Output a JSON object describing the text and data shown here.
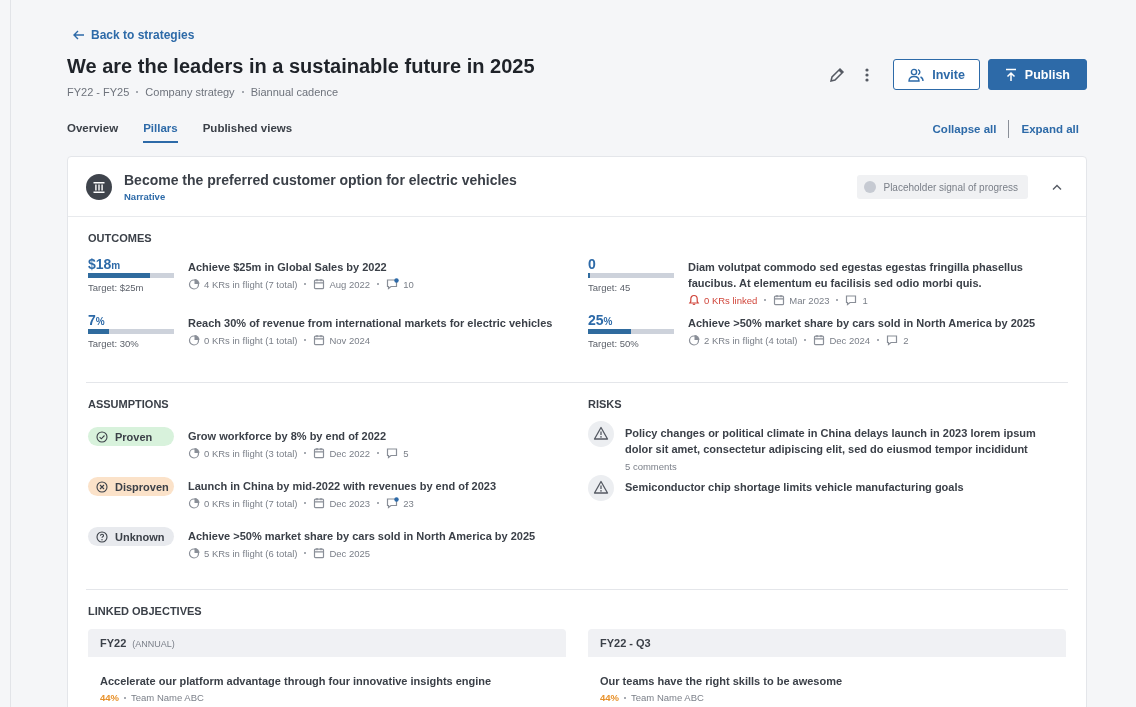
{
  "back_link": "Back to strategies",
  "title": "We are the leaders in a sustainable future in 2025",
  "subtitle": [
    "FY22 - FY25",
    "Company strategy",
    "Biannual cadence"
  ],
  "actions": {
    "invite": "Invite",
    "publish": "Publish"
  },
  "tabs": [
    {
      "label": "Overview",
      "selected": false
    },
    {
      "label": "Pillars",
      "selected": true
    },
    {
      "label": "Published views",
      "selected": false
    }
  ],
  "view_controls": [
    "Collapse all",
    "Expand all"
  ],
  "pillar": {
    "title": "Become the preferred customer option for electric vehicles",
    "link": "Narrative",
    "progress_signal": "Placeholder signal of progress",
    "expanded": true,
    "outcomes_heading": "OUTCOMES",
    "outcomes": [
      {
        "value": "$18",
        "unit": "m",
        "level": 0.72,
        "target": "Target: $25m",
        "title": "Achieve $25m in Global Sales by 2022",
        "meta": [
          {
            "kind": "krs",
            "text": "4 KRs in flight (7 total)"
          },
          {
            "kind": "date",
            "text": "Aug 2022"
          },
          {
            "kind": "comments",
            "text": "10",
            "unread": true
          }
        ]
      },
      {
        "value": "0",
        "level": 0.02,
        "target": "Target: 45",
        "title": "Diam volutpat commodo sed egestas egestas fringilla phasellus faucibus. At elementum eu facilisis sed odio morbi quis.",
        "meta": [
          {
            "kind": "alert",
            "text": "0 KRs linked"
          },
          {
            "kind": "date",
            "text": "Mar 2023"
          },
          {
            "kind": "comments",
            "text": "1",
            "unread": false
          }
        ]
      },
      {
        "value": "7",
        "unit": "%",
        "level": 0.24,
        "target": "Target: 30%",
        "title": "Reach 30% of revenue from international markets for electric vehicles",
        "meta": [
          {
            "kind": "krs",
            "text": "0 KRs in flight (1 total)"
          },
          {
            "kind": "date",
            "text": "Nov 2024"
          }
        ]
      },
      {
        "value": "25",
        "unit": "%",
        "level": 0.5,
        "target": "Target: 50%",
        "title": "Achieve >50% market share by cars sold in North America by 2025",
        "meta": [
          {
            "kind": "krs",
            "text": "2 KRs in flight (4 total)"
          },
          {
            "kind": "date",
            "text": "Dec 2024"
          },
          {
            "kind": "comments",
            "text": "2",
            "unread": false
          }
        ]
      }
    ],
    "assumptions_heading": "ASSUMPTIONS",
    "assumptions": [
      {
        "status": {
          "kind": "proven",
          "label": "Proven"
        },
        "title": "Grow workforce by 8% by end of 2022",
        "meta": [
          {
            "kind": "krs",
            "text": "0 KRs in flight (3 total)"
          },
          {
            "kind": "date",
            "text": "Dec 2022"
          },
          {
            "kind": "comments",
            "text": "5",
            "unread": false
          }
        ]
      },
      {
        "status": {
          "kind": "disproven",
          "label": "Disproven"
        },
        "title": "Launch in China by mid-2022 with revenues by end of 2023",
        "meta": [
          {
            "kind": "krs",
            "text": "0 KRs in flight (7 total)"
          },
          {
            "kind": "date",
            "text": "Dec 2023"
          },
          {
            "kind": "comments",
            "text": "23",
            "unread": true
          }
        ]
      },
      {
        "status": {
          "kind": "unknown",
          "label": "Unknown"
        },
        "title": "Achieve >50% market share by cars sold in North America by 2025",
        "meta": [
          {
            "kind": "krs",
            "text": "5 KRs in flight (6 total)"
          },
          {
            "kind": "date",
            "text": "Dec 2025"
          }
        ]
      }
    ],
    "risks_heading": "RISKS",
    "risks": [
      {
        "title": "Policy changes or political climate in China delays launch in 2023 lorem ipsum dolor sit amet, consectetur adipiscing elit, sed do eiusmod tempor incididunt",
        "comments": "5 comments"
      },
      {
        "title": "Semiconductor chip shortage limits vehicle manufacturing goals"
      }
    ],
    "linked_heading": "LINKED OBJECTIVES",
    "linked_groups": [
      {
        "period": "FY22",
        "note": "(ANNUAL)",
        "objectives": [
          {
            "title": "Accelerate our platform advantage through four innovative insights engine",
            "percent": "44%",
            "team": "Team Name ABC"
          }
        ]
      },
      {
        "period": "FY22 - Q3",
        "objectives": [
          {
            "title": "Our teams have the right skills to be awesome",
            "percent": "44%",
            "team": "Team Name ABC"
          }
        ]
      }
    ]
  }
}
